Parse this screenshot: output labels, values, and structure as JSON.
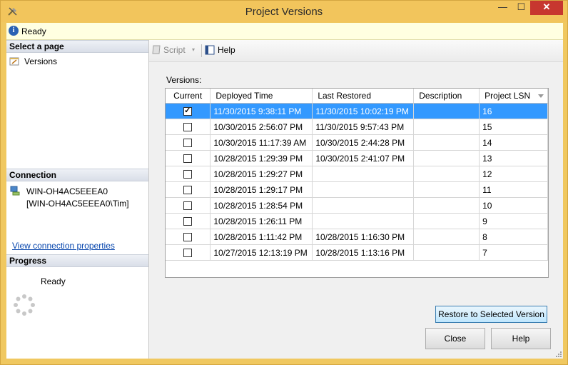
{
  "window": {
    "title": "Project Versions",
    "min_label": "—",
    "max_label": "☐",
    "close_label": "✕"
  },
  "status": {
    "text": "Ready"
  },
  "left": {
    "select_page_header": "Select a page",
    "pages": [
      {
        "label": "Versions"
      }
    ],
    "connection_header": "Connection",
    "server": "WIN-OH4AC5EEEA0",
    "user": "[WIN-OH4AC5EEEA0\\Tim]",
    "view_connection_link": "View connection properties",
    "progress_header": "Progress",
    "progress_status": "Ready"
  },
  "toolbar": {
    "script_label": "Script",
    "dropdown_glyph": "▾",
    "help_label": "Help"
  },
  "versions": {
    "label": "Versions:",
    "columns": [
      "Current",
      "Deployed Time",
      "Last Restored",
      "Description",
      "Project LSN"
    ],
    "rows": [
      {
        "current": true,
        "deployed": "11/30/2015 9:38:11 PM",
        "restored": "11/30/2015 10:02:19 PM",
        "description": "",
        "lsn": "16",
        "selected": true
      },
      {
        "current": false,
        "deployed": "10/30/2015 2:56:07 PM",
        "restored": "11/30/2015 9:57:43 PM",
        "description": "",
        "lsn": "15"
      },
      {
        "current": false,
        "deployed": "10/30/2015 11:17:39 AM",
        "restored": "10/30/2015 2:44:28 PM",
        "description": "",
        "lsn": "14"
      },
      {
        "current": false,
        "deployed": "10/28/2015 1:29:39 PM",
        "restored": "10/30/2015 2:41:07 PM",
        "description": "",
        "lsn": "13"
      },
      {
        "current": false,
        "deployed": "10/28/2015 1:29:27 PM",
        "restored": "",
        "description": "",
        "lsn": "12"
      },
      {
        "current": false,
        "deployed": "10/28/2015 1:29:17 PM",
        "restored": "",
        "description": "",
        "lsn": "11"
      },
      {
        "current": false,
        "deployed": "10/28/2015 1:28:54 PM",
        "restored": "",
        "description": "",
        "lsn": "10"
      },
      {
        "current": false,
        "deployed": "10/28/2015 1:26:11 PM",
        "restored": "",
        "description": "",
        "lsn": "9"
      },
      {
        "current": false,
        "deployed": "10/28/2015 1:11:42 PM",
        "restored": "10/28/2015 1:16:30 PM",
        "description": "",
        "lsn": "8"
      },
      {
        "current": false,
        "deployed": "10/27/2015 12:13:19 PM",
        "restored": "10/28/2015 1:13:16 PM",
        "description": "",
        "lsn": "7"
      }
    ]
  },
  "buttons": {
    "restore": "Restore to Selected Version",
    "close": "Close",
    "help": "Help"
  }
}
